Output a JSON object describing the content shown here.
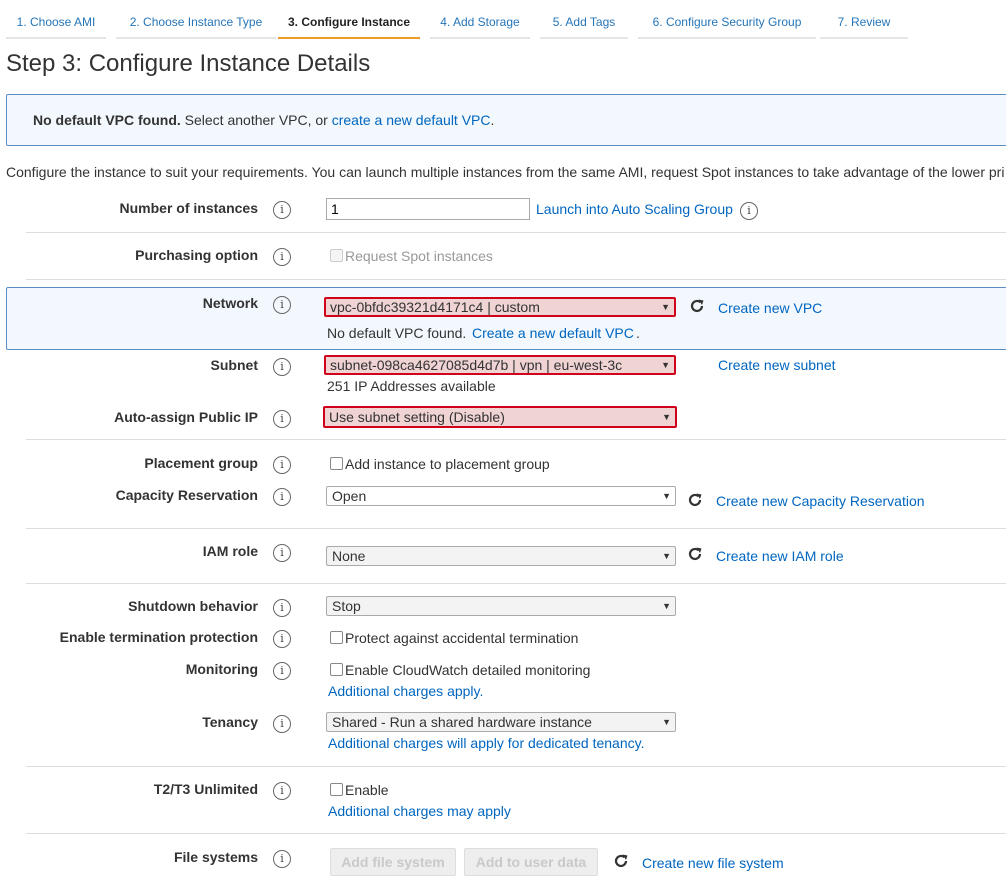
{
  "tabs": [
    {
      "label": "1. Choose AMI"
    },
    {
      "label": "2. Choose Instance Type"
    },
    {
      "label": "3. Configure Instance"
    },
    {
      "label": "4. Add Storage"
    },
    {
      "label": "5. Add Tags"
    },
    {
      "label": "6. Configure Security Group"
    },
    {
      "label": "7. Review"
    }
  ],
  "page_title": "Step 3: Configure Instance Details",
  "alert": {
    "bold": "No default VPC found.",
    "text": " Select another VPC, or ",
    "link": "create a new default VPC",
    "end": "."
  },
  "description": "Configure the instance to suit your requirements. You can launch multiple instances from the same AMI, request Spot instances to take advantage of the lower pri",
  "info_glyph": "i",
  "refresh_icon": "refresh-icon",
  "dropdown_arrow": "▼",
  "fields": {
    "instances": {
      "label": "Number of instances",
      "value": "1",
      "link": "Launch into Auto Scaling Group"
    },
    "purchasing": {
      "label": "Purchasing option",
      "checkbox": "Request Spot instances"
    },
    "network": {
      "label": "Network",
      "value": "vpc-0bfdc39321d4171c4 | custom",
      "link": "Create new VPC",
      "note": "No default VPC found.",
      "note_link": "Create a new default VPC",
      "note_end": "."
    },
    "subnet": {
      "label": "Subnet",
      "value": "subnet-098ca4627085d4d7b | vpn | eu-west-3c",
      "link": "Create new subnet",
      "note": "251 IP Addresses available"
    },
    "public_ip": {
      "label": "Auto-assign Public IP",
      "value": "Use subnet setting (Disable)"
    },
    "placement": {
      "label": "Placement group",
      "checkbox": "Add instance to placement group"
    },
    "capacity": {
      "label": "Capacity Reservation",
      "value": "Open",
      "link": "Create new Capacity Reservation"
    },
    "iam": {
      "label": "IAM role",
      "value": "None",
      "link": "Create new IAM role"
    },
    "shutdown": {
      "label": "Shutdown behavior",
      "value": "Stop"
    },
    "termination": {
      "label": "Enable termination protection",
      "checkbox": "Protect against accidental termination"
    },
    "monitoring": {
      "label": "Monitoring",
      "checkbox": "Enable CloudWatch detailed monitoring",
      "link": "Additional charges apply."
    },
    "tenancy": {
      "label": "Tenancy",
      "value": "Shared - Run a shared hardware instance",
      "link": "Additional charges will apply for dedicated tenancy."
    },
    "t2t3": {
      "label": "T2/T3 Unlimited",
      "checkbox": "Enable",
      "link": "Additional charges may apply"
    },
    "filesystems": {
      "label": "File systems",
      "btn_add": "Add file system",
      "btn_user": "Add to user data",
      "link": "Create new file system"
    }
  },
  "colors": {
    "link": "#0066c0",
    "error_border": "#d0021b",
    "alert_bg": "#f2f8fd",
    "active_tab": "#ec9a2a"
  }
}
